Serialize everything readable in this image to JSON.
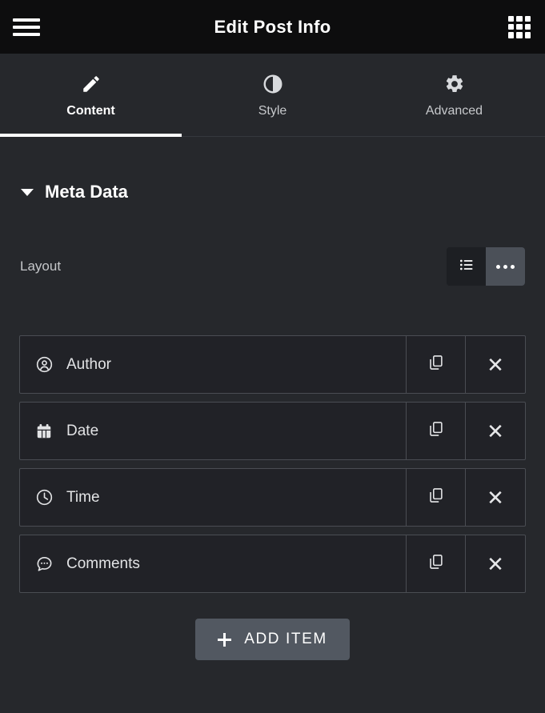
{
  "header": {
    "title": "Edit Post Info",
    "menu_icon": "hamburger-menu-icon",
    "apps_icon": "grid-apps-icon"
  },
  "tabs": [
    {
      "label": "Content",
      "icon": "pencil-icon",
      "active": true
    },
    {
      "label": "Style",
      "icon": "contrast-circle-icon",
      "active": false
    },
    {
      "label": "Advanced",
      "icon": "gear-icon",
      "active": false
    }
  ],
  "section": {
    "title": "Meta Data",
    "expanded": true,
    "caret_icon": "caret-down-icon"
  },
  "layout_control": {
    "label": "Layout",
    "options": [
      {
        "name": "stacked",
        "icon": "list-icon",
        "selected": false
      },
      {
        "name": "inline",
        "icon": "ellipsis-icon",
        "selected": true
      }
    ]
  },
  "items": [
    {
      "label": "Author",
      "icon": "user-circle-icon",
      "duplicate_icon": "duplicate-icon",
      "remove_icon": "close-x-icon"
    },
    {
      "label": "Date",
      "icon": "calendar-icon",
      "duplicate_icon": "duplicate-icon",
      "remove_icon": "close-x-icon"
    },
    {
      "label": "Time",
      "icon": "clock-icon",
      "duplicate_icon": "duplicate-icon",
      "remove_icon": "close-x-icon"
    },
    {
      "label": "Comments",
      "icon": "comment-dots-icon",
      "duplicate_icon": "duplicate-icon",
      "remove_icon": "close-x-icon"
    }
  ],
  "add_button": {
    "label": "ADD ITEM",
    "icon": "plus-icon"
  },
  "colors": {
    "header_bg": "#0d0d0e",
    "panel_bg": "#26282c",
    "row_bg": "#212227",
    "row_border": "#4a4d53",
    "accent_selected": "#4b5058",
    "button_bg": "#525861",
    "text": "#e2e3e5"
  }
}
